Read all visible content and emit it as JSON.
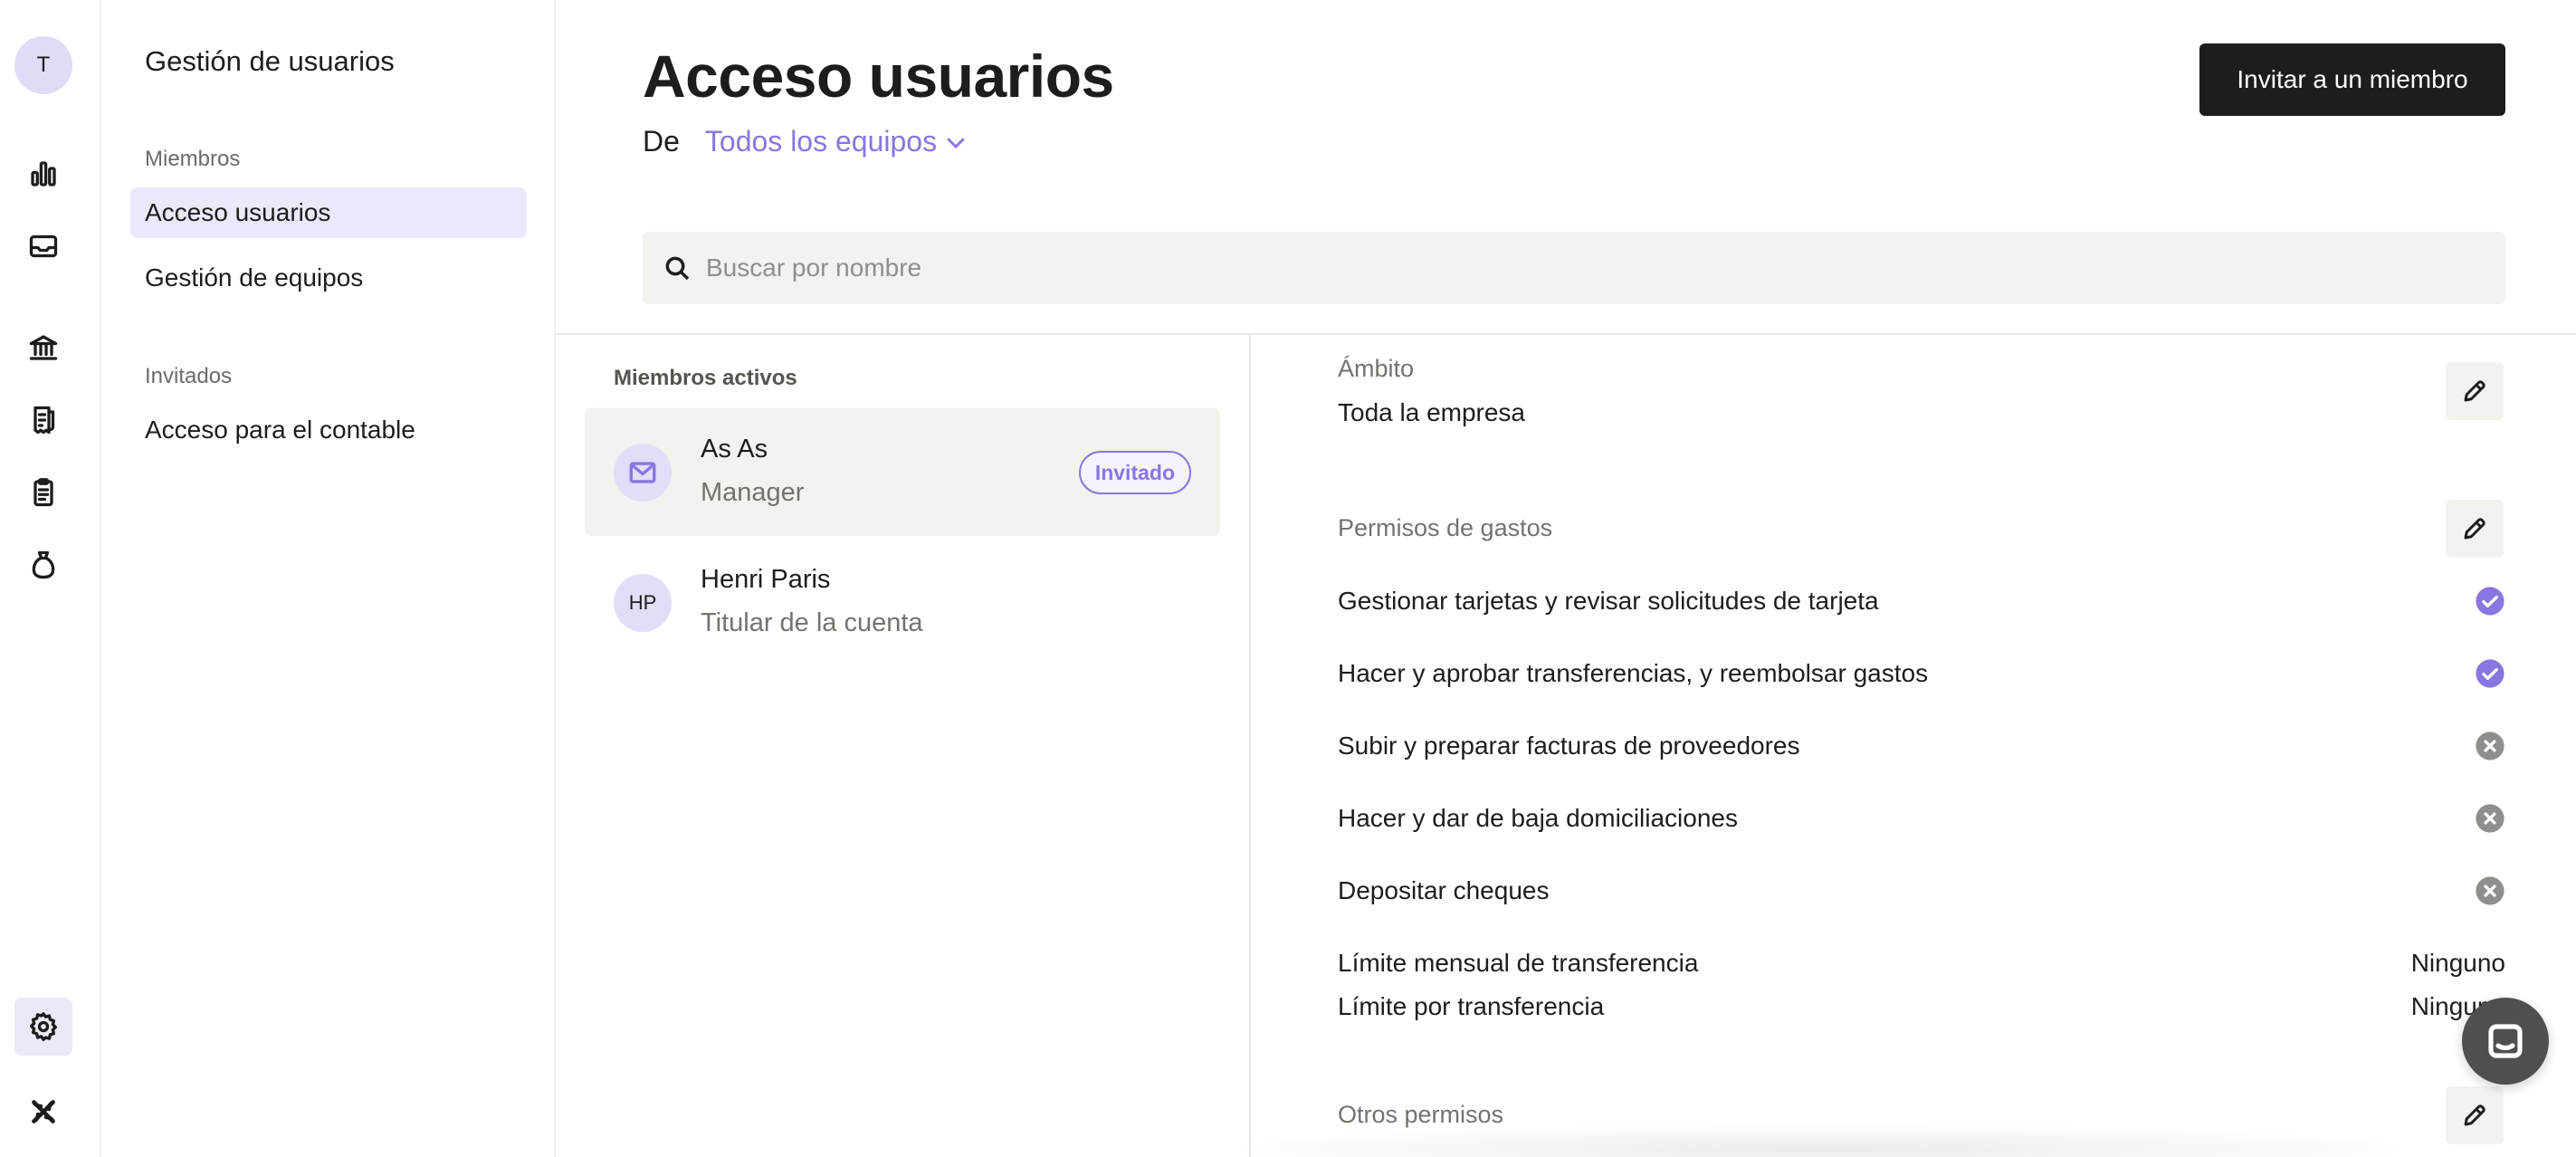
{
  "rail": {
    "avatar_initial": "T",
    "items": [
      {
        "name": "bar-chart-icon"
      },
      {
        "name": "inbox-icon"
      },
      {
        "name": "bank-icon"
      },
      {
        "name": "invoice-icon"
      },
      {
        "name": "clipboard-icon"
      },
      {
        "name": "money-bag-icon"
      },
      {
        "name": "gear-icon",
        "active": true
      },
      {
        "name": "logo-icon"
      }
    ]
  },
  "subnav": {
    "title": "Gestión de usuarios",
    "sections": [
      {
        "label": "Miembros",
        "items": [
          {
            "label": "Acceso usuarios",
            "active": true
          },
          {
            "label": "Gestión de equipos"
          }
        ]
      },
      {
        "label": "Invitados",
        "items": [
          {
            "label": "Acceso para el contable"
          }
        ]
      }
    ]
  },
  "header": {
    "title": "Acceso usuarios",
    "filter_prefix": "De",
    "filter_value": "Todos los equipos",
    "invite_label": "Invitar a un miembro"
  },
  "search": {
    "placeholder": "Buscar por nombre",
    "value": ""
  },
  "members": {
    "section_label": "Miembros activos",
    "list": [
      {
        "name": "As As",
        "role": "Manager",
        "badge": "Invitado",
        "avatar": "mail-icon",
        "selected": true
      },
      {
        "name": "Henri Paris",
        "role": "Titular de la cuenta",
        "initials": "HP"
      }
    ]
  },
  "details": {
    "scope_label": "Ámbito",
    "scope_value": "Toda la empresa",
    "expenses_label": "Permisos de gastos",
    "permissions": [
      {
        "label": "Gestionar tarjetas y revisar solicitudes de tarjeta",
        "granted": true
      },
      {
        "label": "Hacer y aprobar transferencias, y reembolsar gastos",
        "granted": true
      },
      {
        "label": "Subir y preparar facturas de proveedores",
        "granted": false
      },
      {
        "label": "Hacer y dar de baja domiciliaciones",
        "granted": false
      },
      {
        "label": "Depositar cheques",
        "granted": false
      }
    ],
    "limits": [
      {
        "label": "Límite mensual de transferencia",
        "value": "Ninguno"
      },
      {
        "label": "Límite por transferencia",
        "value": "Ninguno"
      }
    ],
    "other_label": "Otros permisos"
  },
  "colors": {
    "accent": "#8b75e0",
    "dark": "#1d1d1b",
    "granted": "#8b75e0",
    "denied": "#8e8e8a"
  }
}
